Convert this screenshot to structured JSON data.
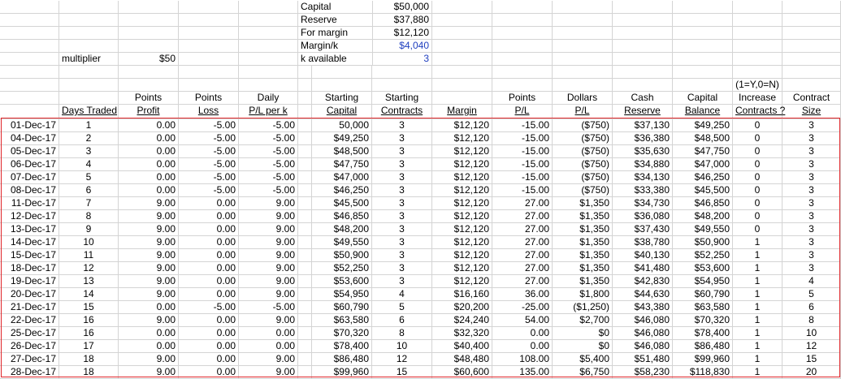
{
  "params": {
    "capital_label": "Capital",
    "capital": "$50,000",
    "reserve_label": "Reserve",
    "reserve": "$37,880",
    "for_margin_label": "For margin",
    "for_margin": "$12,120",
    "margin_k_label": "Margin/k",
    "margin_k": "$4,040",
    "k_available_label": "k available",
    "k_available": "3",
    "multiplier_label": "multiplier",
    "multiplier": "$50",
    "increase_note": "(1=Y,0=N)"
  },
  "headers": {
    "top": [
      "",
      "",
      "Points",
      "Points",
      "Daily",
      "",
      "Starting",
      "Starting",
      "",
      "Points",
      "Dollars",
      "Cash",
      "Capital",
      "Increase",
      "Contract"
    ],
    "bottom": [
      "",
      "Days Traded",
      "Profit",
      "Loss",
      "P/L per k",
      "",
      "Capital",
      "Contracts",
      "Margin",
      "P/L",
      "P/L",
      "Reserve",
      "Balance",
      "Contracts ?",
      "Size"
    ]
  },
  "rows": [
    [
      "01-Dec-17",
      "1",
      "0.00",
      "-5.00",
      "-5.00",
      "",
      "50,000",
      "3",
      "$12,120",
      "-15.00",
      "($750)",
      "$37,130",
      "$49,250",
      "0",
      "3"
    ],
    [
      "04-Dec-17",
      "2",
      "0.00",
      "-5.00",
      "-5.00",
      "",
      "$49,250",
      "3",
      "$12,120",
      "-15.00",
      "($750)",
      "$36,380",
      "$48,500",
      "0",
      "3"
    ],
    [
      "05-Dec-17",
      "3",
      "0.00",
      "-5.00",
      "-5.00",
      "",
      "$48,500",
      "3",
      "$12,120",
      "-15.00",
      "($750)",
      "$35,630",
      "$47,750",
      "0",
      "3"
    ],
    [
      "06-Dec-17",
      "4",
      "0.00",
      "-5.00",
      "-5.00",
      "",
      "$47,750",
      "3",
      "$12,120",
      "-15.00",
      "($750)",
      "$34,880",
      "$47,000",
      "0",
      "3"
    ],
    [
      "07-Dec-17",
      "5",
      "0.00",
      "-5.00",
      "-5.00",
      "",
      "$47,000",
      "3",
      "$12,120",
      "-15.00",
      "($750)",
      "$34,130",
      "$46,250",
      "0",
      "3"
    ],
    [
      "08-Dec-17",
      "6",
      "0.00",
      "-5.00",
      "-5.00",
      "",
      "$46,250",
      "3",
      "$12,120",
      "-15.00",
      "($750)",
      "$33,380",
      "$45,500",
      "0",
      "3"
    ],
    [
      "11-Dec-17",
      "7",
      "9.00",
      "0.00",
      "9.00",
      "",
      "$45,500",
      "3",
      "$12,120",
      "27.00",
      "$1,350",
      "$34,730",
      "$46,850",
      "0",
      "3"
    ],
    [
      "12-Dec-17",
      "8",
      "9.00",
      "0.00",
      "9.00",
      "",
      "$46,850",
      "3",
      "$12,120",
      "27.00",
      "$1,350",
      "$36,080",
      "$48,200",
      "0",
      "3"
    ],
    [
      "13-Dec-17",
      "9",
      "9.00",
      "0.00",
      "9.00",
      "",
      "$48,200",
      "3",
      "$12,120",
      "27.00",
      "$1,350",
      "$37,430",
      "$49,550",
      "0",
      "3"
    ],
    [
      "14-Dec-17",
      "10",
      "9.00",
      "0.00",
      "9.00",
      "",
      "$49,550",
      "3",
      "$12,120",
      "27.00",
      "$1,350",
      "$38,780",
      "$50,900",
      "1",
      "3"
    ],
    [
      "15-Dec-17",
      "11",
      "9.00",
      "0.00",
      "9.00",
      "",
      "$50,900",
      "3",
      "$12,120",
      "27.00",
      "$1,350",
      "$40,130",
      "$52,250",
      "1",
      "3"
    ],
    [
      "18-Dec-17",
      "12",
      "9.00",
      "0.00",
      "9.00",
      "",
      "$52,250",
      "3",
      "$12,120",
      "27.00",
      "$1,350",
      "$41,480",
      "$53,600",
      "1",
      "3"
    ],
    [
      "19-Dec-17",
      "13",
      "9.00",
      "0.00",
      "9.00",
      "",
      "$53,600",
      "3",
      "$12,120",
      "27.00",
      "$1,350",
      "$42,830",
      "$54,950",
      "1",
      "4"
    ],
    [
      "20-Dec-17",
      "14",
      "9.00",
      "0.00",
      "9.00",
      "",
      "$54,950",
      "4",
      "$16,160",
      "36.00",
      "$1,800",
      "$44,630",
      "$60,790",
      "1",
      "5"
    ],
    [
      "21-Dec-17",
      "15",
      "0.00",
      "-5.00",
      "-5.00",
      "",
      "$60,790",
      "5",
      "$20,200",
      "-25.00",
      "($1,250)",
      "$43,380",
      "$63,580",
      "1",
      "6"
    ],
    [
      "22-Dec-17",
      "16",
      "9.00",
      "0.00",
      "9.00",
      "",
      "$63,580",
      "6",
      "$24,240",
      "54.00",
      "$2,700",
      "$46,080",
      "$70,320",
      "1",
      "8"
    ],
    [
      "25-Dec-17",
      "16",
      "0.00",
      "0.00",
      "0.00",
      "",
      "$70,320",
      "8",
      "$32,320",
      "0.00",
      "$0",
      "$46,080",
      "$78,400",
      "1",
      "10"
    ],
    [
      "26-Dec-17",
      "17",
      "0.00",
      "0.00",
      "0.00",
      "",
      "$78,400",
      "10",
      "$40,400",
      "0.00",
      "$0",
      "$46,080",
      "$86,480",
      "1",
      "12"
    ],
    [
      "27-Dec-17",
      "18",
      "9.00",
      "0.00",
      "9.00",
      "",
      "$86,480",
      "12",
      "$48,480",
      "108.00",
      "$5,400",
      "$51,480",
      "$99,960",
      "1",
      "15"
    ],
    [
      "28-Dec-17",
      "18",
      "9.00",
      "0.00",
      "9.00",
      "",
      "$99,960",
      "15",
      "$60,600",
      "135.00",
      "$6,750",
      "$58,230",
      "$118,830",
      "1",
      "20"
    ]
  ]
}
